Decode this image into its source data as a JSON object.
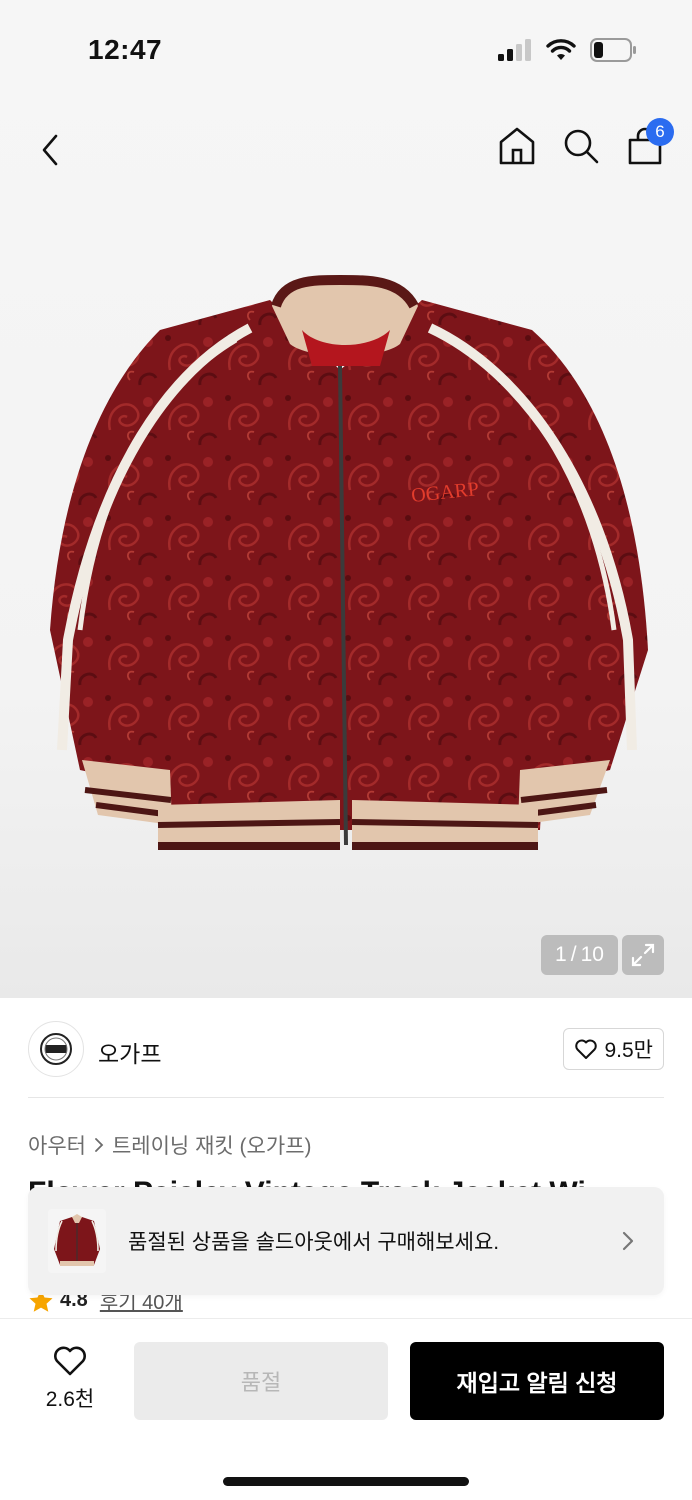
{
  "status_bar": {
    "time": "12:47"
  },
  "nav": {
    "cart_count": "6"
  },
  "gallery": {
    "current": "1",
    "separator": "/",
    "total": "10"
  },
  "brand": {
    "name": "오가프",
    "likes": "9.5만"
  },
  "breadcrumb": {
    "category": "아우터",
    "subcategory": "트레이닝 재킷 (오가프)"
  },
  "product": {
    "title": "Flower Paisley Vintage Track Jacket Wi"
  },
  "rating": {
    "value": "4.8",
    "reviews": "후기 40개"
  },
  "toast": {
    "message": "품절된 상품을 솔드아웃에서 구매해보세요."
  },
  "bottom_bar": {
    "wish_count": "2.6천",
    "soldout_label": "품절",
    "restock_label": "재입고 알림 신청"
  },
  "colors": {
    "badge_blue": "#2b6cf0",
    "primary_black": "#000000",
    "star": "#f7a500",
    "jacket_red": "#7a1418"
  },
  "icons": [
    "back-icon",
    "home-icon",
    "search-icon",
    "cart-icon",
    "expand-icon",
    "heart-icon",
    "star-icon",
    "chevron-right-icon"
  ]
}
